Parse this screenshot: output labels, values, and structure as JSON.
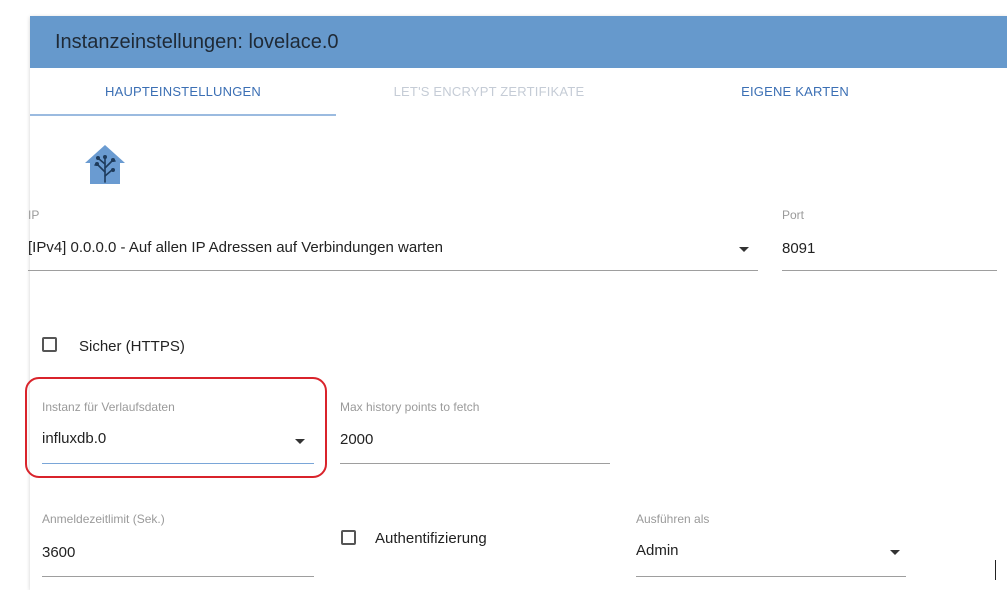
{
  "dialog": {
    "title": "Instanzeinstellungen: lovelace.0",
    "accent_color": "#6699cc"
  },
  "tabs": [
    {
      "label": "HAUPTEINSTELLUNGEN",
      "state": "active"
    },
    {
      "label": "LET'S ENCRYPT ZERTIFIKATE",
      "state": "disabled"
    },
    {
      "label": "EIGENE KARTEN",
      "state": "normal"
    }
  ],
  "logo": {
    "icon": "home-assistant-logo-icon"
  },
  "ip": {
    "label": "IP",
    "value": "[IPv4] 0.0.0.0 - Auf allen IP Adressen auf Verbindungen warten",
    "dropdown_icon": "caret-down-icon"
  },
  "port": {
    "label": "Port",
    "value": "8091"
  },
  "secure": {
    "label": "Sicher (HTTPS)",
    "checked": false
  },
  "history_instance": {
    "label": "Instanz für Verlaufsdaten",
    "value": "influxdb.0",
    "dropdown_icon": "caret-down-icon",
    "highlight_color": "#d9232b"
  },
  "max_history": {
    "label": "Max history points to fetch",
    "value": "2000"
  },
  "login_timeout": {
    "label": "Anmeldezeitlimit (Sek.)",
    "value": "3600"
  },
  "auth": {
    "label": "Authentifizierung",
    "checked": false
  },
  "run_as": {
    "label": "Ausführen als",
    "value": "Admin",
    "dropdown_icon": "caret-down-icon"
  }
}
